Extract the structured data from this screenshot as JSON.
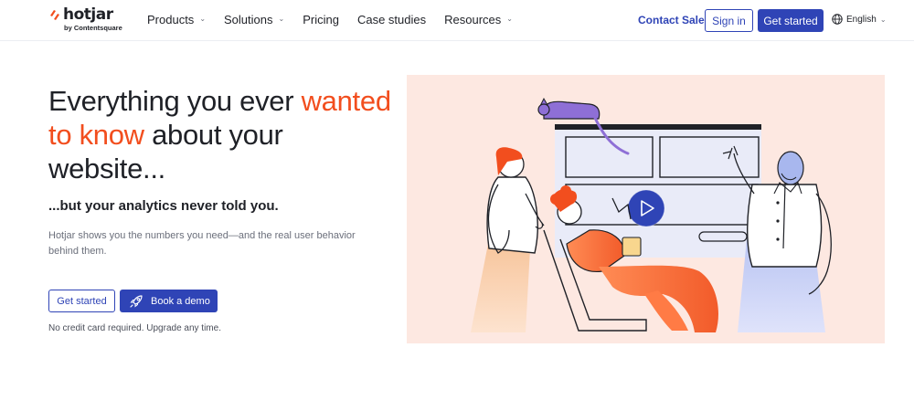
{
  "header": {
    "logo": {
      "word": "hotjar",
      "by": "by Contentsquare"
    },
    "nav": [
      {
        "label": "Products",
        "has_dropdown": true
      },
      {
        "label": "Solutions",
        "has_dropdown": true
      },
      {
        "label": "Pricing",
        "has_dropdown": false
      },
      {
        "label": "Case studies",
        "has_dropdown": false
      },
      {
        "label": "Resources",
        "has_dropdown": true
      }
    ],
    "contact_sales": "Contact Sales",
    "sign_in": "Sign in",
    "get_started": "Get started",
    "language": "English"
  },
  "hero": {
    "title_part1": "Everything you ever ",
    "title_accent": "wanted to know",
    "title_part2": " about your website...",
    "subtitle": "...but your analytics never told you.",
    "description": "Hotjar shows you the numbers you need—and the real user behavior behind them.",
    "cta_primary": "Get started",
    "cta_demo": "Book a demo",
    "note": "No credit card required. Upgrade any time."
  },
  "illustration": {
    "icon": "video-play-icon"
  },
  "colors": {
    "brand_blue": "#2f44b6",
    "accent_orange": "#f24e1e",
    "illustration_bg": "#fde8e1"
  }
}
